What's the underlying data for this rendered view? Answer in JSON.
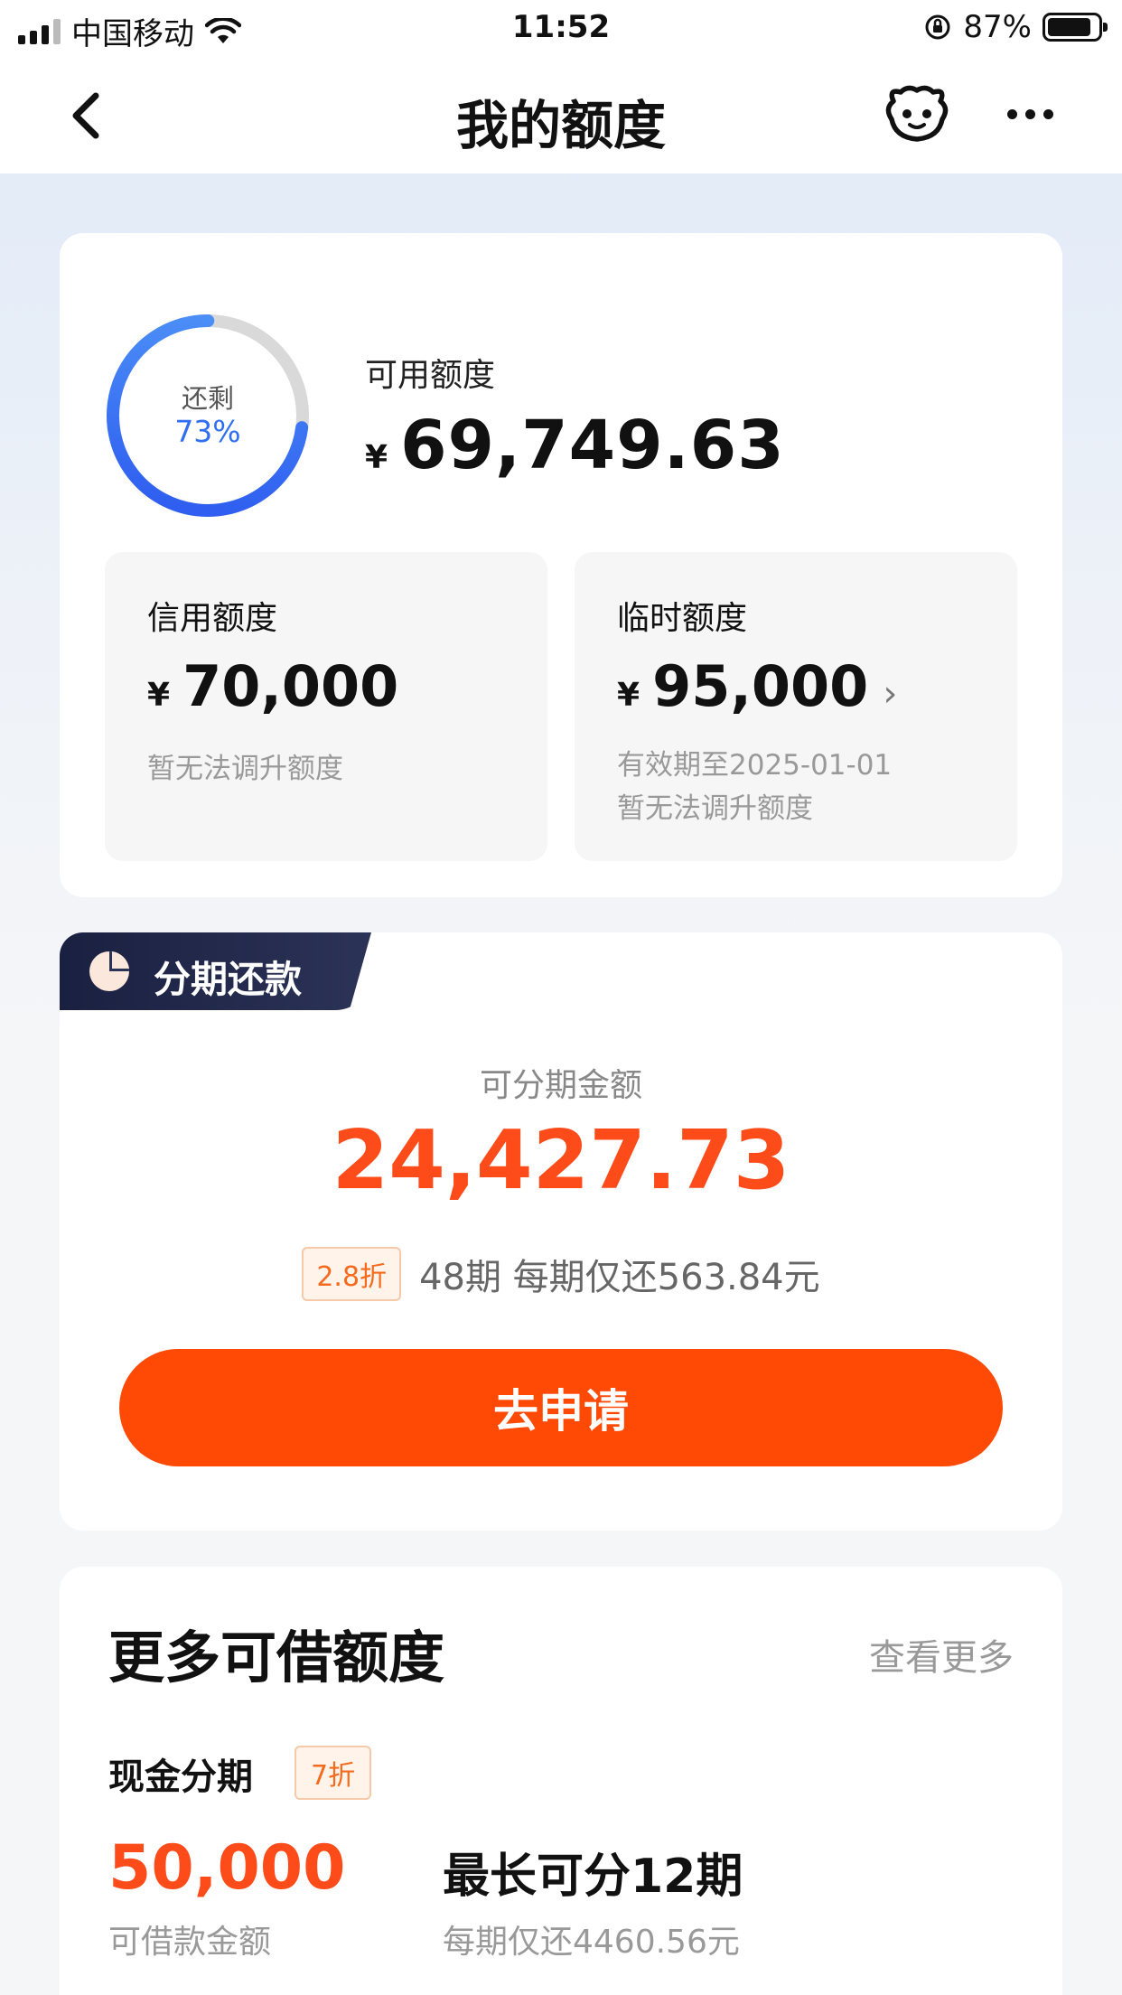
{
  "status_bar": {
    "carrier": "中国移动",
    "time": "11:52",
    "battery": "87%",
    "battery_level": 0.87
  },
  "header": {
    "title": "我的额度",
    "back_icon": "chevron-left-icon",
    "robot_icon": "robot-icon",
    "more_icon": "more-dots-icon"
  },
  "quota": {
    "ring_label": "还剩",
    "ring_percent": "73%",
    "remaining_fraction": 0.73,
    "available_label": "可用额度",
    "currency": "¥",
    "available_amount": "69,749.63",
    "credit": {
      "title": "信用额度",
      "amount": "70,000",
      "note": "暂无法调升额度"
    },
    "temporary": {
      "title": "临时额度",
      "amount": "95,000",
      "validity": "有效期至2025-01-01",
      "note": "暂无法调升额度"
    }
  },
  "installment": {
    "tag": "分期还款",
    "label": "可分期金额",
    "amount": "24,427.73",
    "discount": "2.8折",
    "description": "48期  每期仅还563.84元",
    "apply_button": "去申请"
  },
  "more_quota": {
    "title": "更多可借额度",
    "link": "查看更多",
    "cash": {
      "title": "现金分期",
      "discount": "7折",
      "amount": "50,000",
      "amount_label": "可借款金额",
      "term": "最长可分12期",
      "term_note": "每期仅还4460.56元"
    }
  },
  "colors": {
    "accent_orange": "#fe4b1a",
    "ring_blue": "#2f6ef0",
    "tag_dark": "#1a2040"
  }
}
